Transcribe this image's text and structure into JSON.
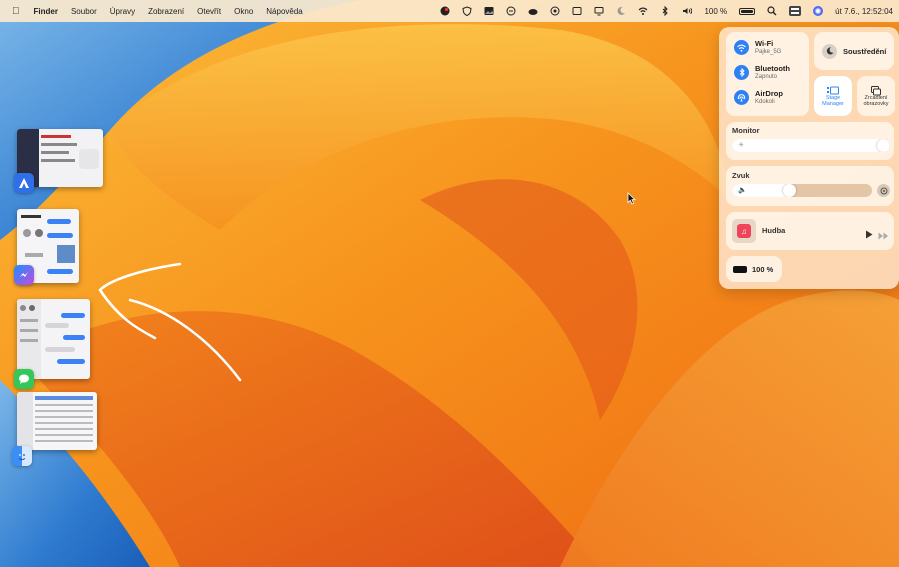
{
  "menubar": {
    "apple_icon": "apple-logo-icon",
    "items": [
      "Finder",
      "Soubor",
      "Úpravy",
      "Zobrazení",
      "Otevřít",
      "Okno",
      "Nápověda"
    ],
    "battery_percent": "100 %",
    "datetime": "út 7.6., 12:52:04"
  },
  "stage_manager": {
    "apps": [
      {
        "name": "Arc",
        "icon": "arc-browser-icon",
        "color": "#2f6fe8"
      },
      {
        "name": "Messenger",
        "icon": "messenger-icon",
        "color": "#b44bea"
      },
      {
        "name": "Zprávy",
        "icon": "messages-icon",
        "color": "#34c759"
      },
      {
        "name": "Finder",
        "icon": "finder-icon",
        "color": "#3a8ef6"
      }
    ]
  },
  "control_center": {
    "wifi": {
      "label": "Wi-Fi",
      "sub": "Pajke_5G"
    },
    "bluetooth": {
      "label": "Bluetooth",
      "sub": "Zapnuto"
    },
    "airdrop": {
      "label": "AirDrop",
      "sub": "Kdokoli"
    },
    "focus": {
      "label": "Soustředění"
    },
    "stage_manager": {
      "line1": "Stage",
      "line2": "Manager",
      "active": true
    },
    "mirroring": {
      "line1": "Zrcadlení",
      "line2": "obrazovky"
    },
    "display": {
      "label": "Monitor",
      "value_percent": 100
    },
    "sound": {
      "label": "Zvuk",
      "value_percent": 40
    },
    "music": {
      "label": "Hudba"
    },
    "battery": {
      "label": "100 %"
    }
  },
  "colors": {
    "accent": "#2f80f5",
    "wallpaper_orange": "#f58a1e",
    "wallpaper_blue": "#2a72cc",
    "music_red": "#f0445a"
  }
}
